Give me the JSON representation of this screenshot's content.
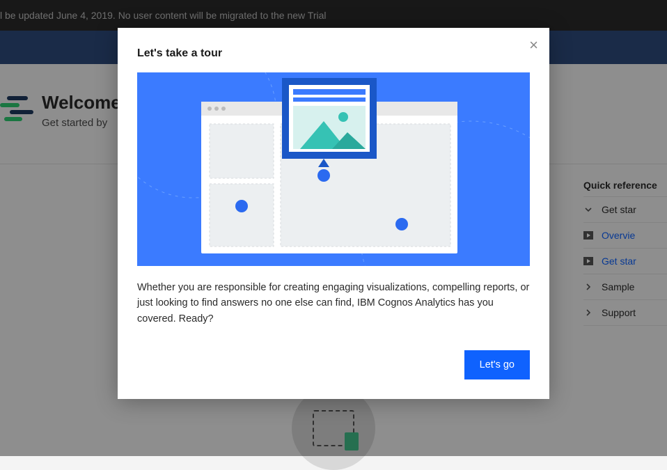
{
  "banner": {
    "text": "l be updated June 4, 2019. No user content will be migrated to the new Trial"
  },
  "welcome": {
    "title": "Welcome",
    "subtitle": "Get started by"
  },
  "quickref": {
    "title": "Quick reference",
    "items": [
      {
        "label": "Get star",
        "icon": "chevron-down",
        "link": false
      },
      {
        "label": "Overvie",
        "icon": "play",
        "link": true
      },
      {
        "label": "Get star",
        "icon": "play",
        "link": true
      },
      {
        "label": "Sample",
        "icon": "chevron-right",
        "link": false
      },
      {
        "label": "Support",
        "icon": "chevron-right",
        "link": false
      }
    ]
  },
  "modal": {
    "title": "Let's take a tour",
    "body": "Whether you are responsible for creating engaging visualizations, compelling reports, or just looking to find answers no one else can find, IBM Cognos Analytics has you covered. Ready?",
    "primary_label": "Let's go",
    "close_label": "×"
  },
  "colors": {
    "primary": "#0f62fe",
    "hero_bg": "#3b7bff",
    "accent_teal": "#36c2b4"
  }
}
